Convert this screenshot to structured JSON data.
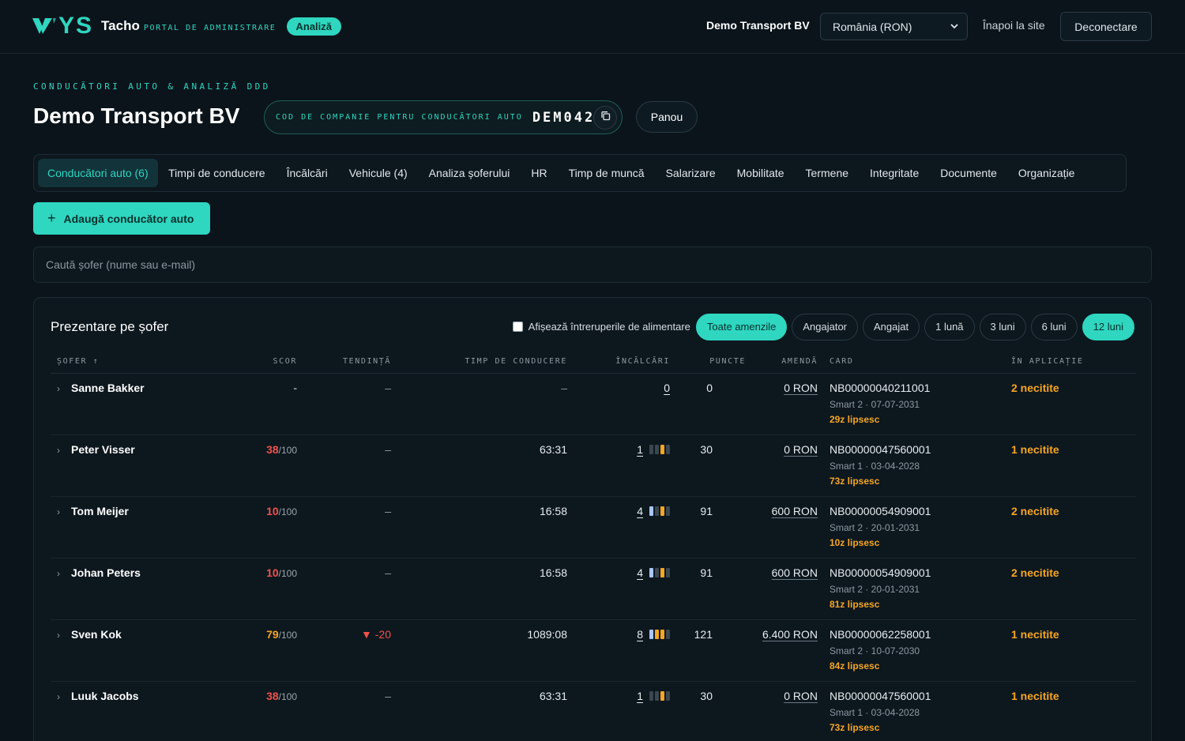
{
  "header": {
    "logo_text": "YS",
    "product": "Tacho",
    "portal": "PORTAL DE ADMINISTRARE",
    "badge": "Analiză",
    "company": "Demo Transport BV",
    "country_select": "România (RON)",
    "back_link": "Înapoi la site",
    "logout": "Deconectare"
  },
  "page": {
    "eyebrow": "CONDUCĂTORI AUTO & ANALIZĂ DDD",
    "title": "Demo Transport BV",
    "company_code_label": "COD DE COMPANIE PENTRU CONDUCĂTORI AUTO",
    "company_code": "DEM042",
    "dashboard_button": "Panou"
  },
  "tabs": [
    {
      "label": "Conducători auto (6)",
      "active": true
    },
    {
      "label": "Timpi de conducere"
    },
    {
      "label": "Încălcări"
    },
    {
      "label": "Vehicule (4)"
    },
    {
      "label": "Analiza șoferului"
    },
    {
      "label": "HR"
    },
    {
      "label": "Timp de muncă"
    },
    {
      "label": "Salarizare"
    },
    {
      "label": "Mobilitate"
    },
    {
      "label": "Termene"
    },
    {
      "label": "Integritate"
    },
    {
      "label": "Documente"
    },
    {
      "label": "Organizație"
    }
  ],
  "add_driver": "Adaugă conducător auto",
  "search_placeholder": "Caută șofer (nume sau e-mail)",
  "panel": {
    "title": "Prezentare pe șofer",
    "fuel_toggle": "Afișează întreruperile de alimentare",
    "fine_filters": [
      "Toate amenzile",
      "Angajator",
      "Angajat"
    ],
    "period_filters": [
      "1 lună",
      "3 luni",
      "6 luni",
      "12 luni"
    ],
    "active_fine_filter": "Toate amenzile",
    "active_period": "12 luni"
  },
  "columns": {
    "driver": "ȘOFER ↑",
    "score": "SCOR",
    "trend": "TENDINȚĂ",
    "drive_time": "TIMP DE CONDUCERE",
    "infringements": "ÎNCĂLCĂRI",
    "points": "PUNCTE",
    "fine": "AMENDĂ",
    "card": "CARD",
    "in_app": "ÎN APLICAȚIE"
  },
  "colors": {
    "accent": "#2fd6c0",
    "warning": "#f5a623",
    "danger": "#f0524b",
    "bar_blue": "#a9c6ff",
    "bar_orange": "#f5a623",
    "bar_gray": "#3a4650"
  },
  "rows": [
    {
      "name": "Sanne Bakker",
      "score": "-",
      "score_den": "",
      "score_color": "#8c9aa2",
      "trend": "–",
      "trend_neg": false,
      "drive": "–",
      "infr": "0",
      "bars": [],
      "points": "0",
      "fine": "0 RON",
      "card": "NB00000040211001",
      "card_meta": "Smart 2 · 07-07-2031",
      "missing": "29z lipsesc",
      "in_app": "2 necitite"
    },
    {
      "name": "Peter Visser",
      "score": "38",
      "score_den": "/100",
      "score_color": "#f0524b",
      "trend": "–",
      "trend_neg": false,
      "drive": "63:31",
      "infr": "1",
      "bars": [
        "gray",
        "gray",
        "orange",
        "gray"
      ],
      "points": "30",
      "fine": "0 RON",
      "card": "NB00000047560001",
      "card_meta": "Smart 1 · 03-04-2028",
      "missing": "73z lipsesc",
      "in_app": "1 necitite"
    },
    {
      "name": "Tom Meijer",
      "score": "10",
      "score_den": "/100",
      "score_color": "#f0524b",
      "trend": "–",
      "trend_neg": false,
      "drive": "16:58",
      "infr": "4",
      "bars": [
        "blue",
        "gray",
        "orange",
        "gray"
      ],
      "points": "91",
      "fine": "600 RON",
      "card": "NB00000054909001",
      "card_meta": "Smart 2 · 20-01-2031",
      "missing": "10z lipsesc",
      "in_app": "2 necitite"
    },
    {
      "name": "Johan Peters",
      "score": "10",
      "score_den": "/100",
      "score_color": "#f0524b",
      "trend": "–",
      "trend_neg": false,
      "drive": "16:58",
      "infr": "4",
      "bars": [
        "blue",
        "gray",
        "orange",
        "gray"
      ],
      "points": "91",
      "fine": "600 RON",
      "card": "NB00000054909001",
      "card_meta": "Smart 2 · 20-01-2031",
      "missing": "81z lipsesc",
      "in_app": "2 necitite"
    },
    {
      "name": "Sven Kok",
      "score": "79",
      "score_den": "/100",
      "score_color": "#f5a623",
      "trend": "▼ -20",
      "trend_neg": true,
      "drive": "1089:08",
      "infr": "8",
      "bars": [
        "blue",
        "orange",
        "orange",
        "gray"
      ],
      "points": "121",
      "fine": "6.400 RON",
      "card": "NB00000062258001",
      "card_meta": "Smart 2 · 10-07-2030",
      "missing": "84z lipsesc",
      "in_app": "1 necitite"
    },
    {
      "name": "Luuk Jacobs",
      "score": "38",
      "score_den": "/100",
      "score_color": "#f0524b",
      "trend": "–",
      "trend_neg": false,
      "drive": "63:31",
      "infr": "1",
      "bars": [
        "gray",
        "gray",
        "orange",
        "gray"
      ],
      "points": "30",
      "fine": "0 RON",
      "card": "NB00000047560001",
      "card_meta": "Smart 1 · 03-04-2028",
      "missing": "73z lipsesc",
      "in_app": "1 necitite"
    }
  ]
}
